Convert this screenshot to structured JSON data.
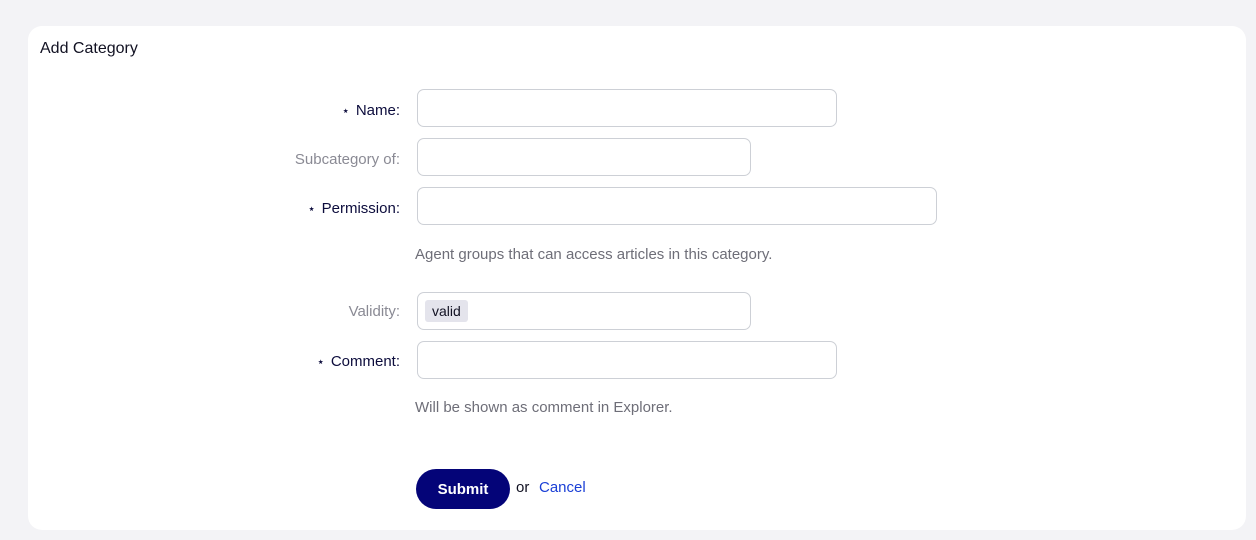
{
  "panel": {
    "title": "Add Category"
  },
  "form": {
    "name": {
      "label": "Name:",
      "required": true,
      "value": ""
    },
    "subcategory": {
      "label": "Subcategory of:",
      "required": false,
      "value": ""
    },
    "permission": {
      "label": "Permission:",
      "required": true,
      "value": "",
      "hint": "Agent groups that can access articles in this category."
    },
    "validity": {
      "label": "Validity:",
      "required": false,
      "selected": "valid"
    },
    "comment": {
      "label": "Comment:",
      "required": true,
      "value": "",
      "hint": "Will be shown as comment in Explorer."
    },
    "required_marker": "⋆",
    "submit_label": "Submit",
    "or_text": "or",
    "cancel_label": "Cancel"
  },
  "colors": {
    "primary": "#040478",
    "link": "#1a3fd6",
    "background": "#f3f3f6"
  }
}
